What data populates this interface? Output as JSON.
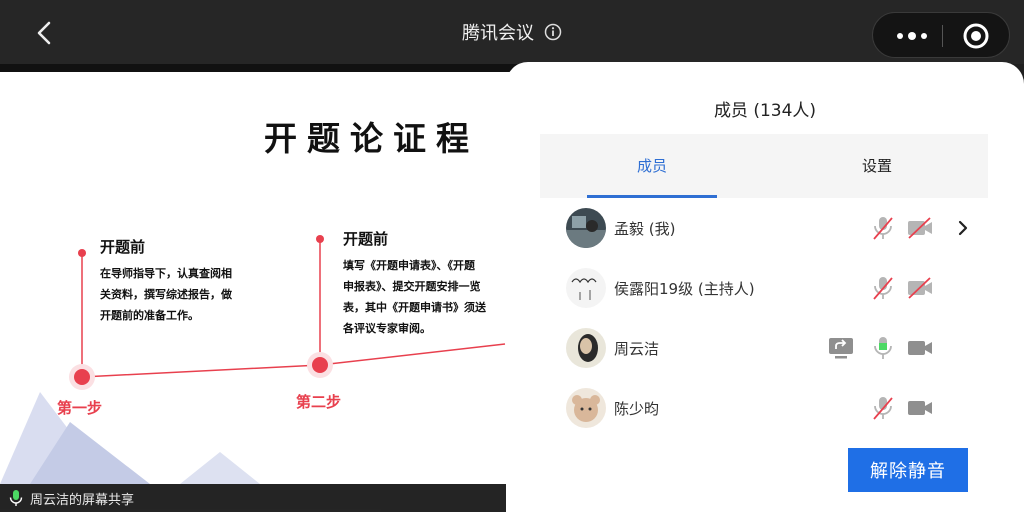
{
  "topbar": {
    "title": "腾讯会议"
  },
  "slide": {
    "title": "开题论证程",
    "step1": {
      "heading": "开题前",
      "body": [
        "在导师指导下，认真查阅相",
        "关资料，撰写综述报告，做",
        "开题前的准备工作。"
      ],
      "label": "第一步"
    },
    "step2": {
      "heading": "开题前",
      "body": [
        "填写《开题申请表》、《开题",
        "申报表》、提交开题安排一览",
        "表，其中《开题申请书》须送",
        "各评议专家审阅。"
      ],
      "label": "第二步"
    },
    "accent_color": "#e8404e"
  },
  "share_bar": {
    "text": "周云洁的屏幕共享"
  },
  "panel": {
    "title": "成员 (134人)",
    "tabs": [
      {
        "label": "成员",
        "active": true
      },
      {
        "label": "设置",
        "active": false
      }
    ],
    "members": [
      {
        "name": "孟毅 (我)",
        "mic": "muted",
        "camera": "off",
        "sharing": false,
        "chevron": true
      },
      {
        "name": "侯露阳19级 (主持人)",
        "mic": "muted",
        "camera": "off",
        "sharing": false,
        "chevron": false
      },
      {
        "name": "周云洁",
        "mic": "active",
        "camera": "on",
        "sharing": true,
        "chevron": false
      },
      {
        "name": "陈少昀",
        "mic": "muted",
        "camera": "on",
        "sharing": false,
        "chevron": false
      }
    ],
    "unmute_button": "解除静音",
    "accent_color": "#2f6fd3"
  }
}
